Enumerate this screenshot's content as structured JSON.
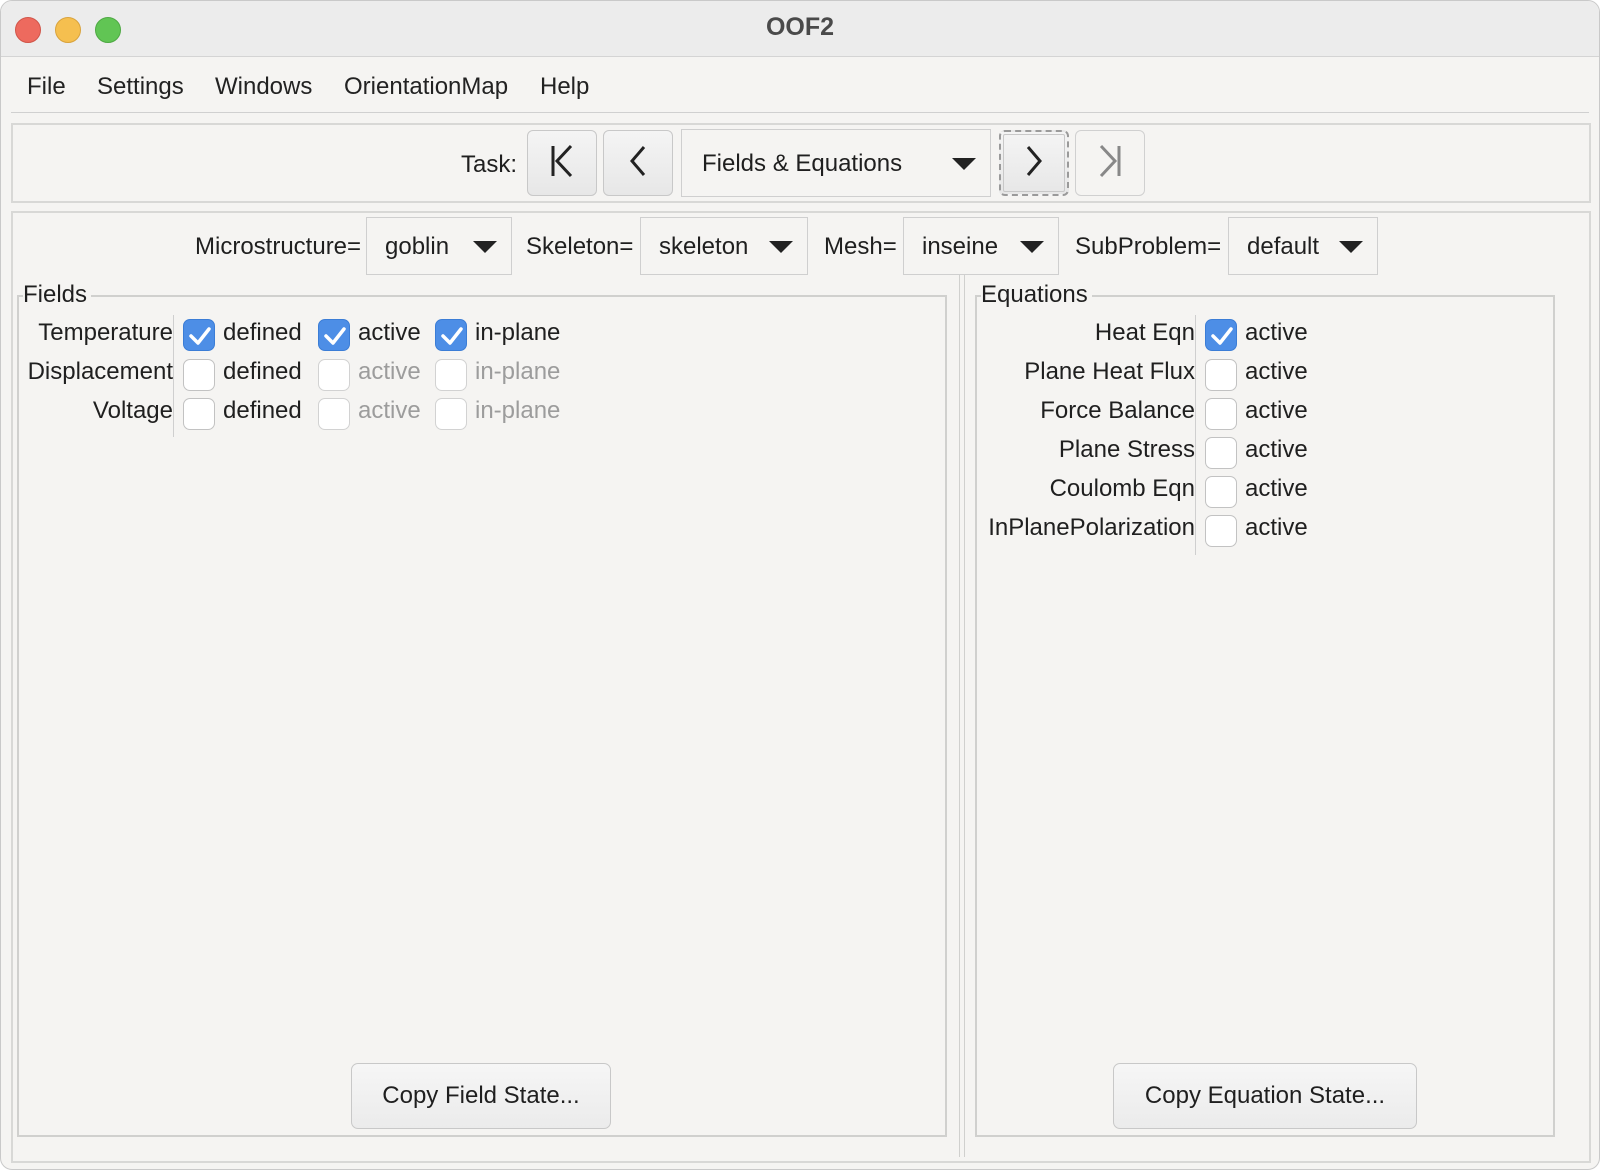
{
  "window": {
    "title": "OOF2"
  },
  "menu": [
    "File",
    "Settings",
    "Windows",
    "OrientationMap",
    "Help"
  ],
  "task": {
    "label": "Task:",
    "selected": "Fields & Equations"
  },
  "choosers": {
    "microstructure": {
      "label": "Microstructure=",
      "value": "goblin"
    },
    "skeleton": {
      "label": "Skeleton=",
      "value": "skeleton"
    },
    "mesh": {
      "label": "Mesh=",
      "value": "inseine"
    },
    "subproblem": {
      "label": "SubProblem=",
      "value": "default"
    }
  },
  "fields": {
    "title": "Fields",
    "rows": [
      {
        "name": "Temperature",
        "defined_label": "defined",
        "defined": true,
        "active_label": "active",
        "active": true,
        "inplane_label": "in-plane",
        "inplane": true
      },
      {
        "name": "Displacement",
        "defined_label": "defined",
        "defined": false,
        "active_label": "active",
        "active": false,
        "inplane_label": "in-plane",
        "inplane": false
      },
      {
        "name": "Voltage",
        "defined_label": "defined",
        "defined": false,
        "active_label": "active",
        "active": false,
        "inplane_label": "in-plane",
        "inplane": false
      }
    ],
    "copy_button": "Copy Field State..."
  },
  "equations": {
    "title": "Equations",
    "rows": [
      {
        "name": "Heat Eqn",
        "active_label": "active",
        "active": true
      },
      {
        "name": "Plane Heat Flux",
        "active_label": "active",
        "active": false
      },
      {
        "name": "Force Balance",
        "active_label": "active",
        "active": false
      },
      {
        "name": "Plane Stress",
        "active_label": "active",
        "active": false
      },
      {
        "name": "Coulomb Eqn",
        "active_label": "active",
        "active": false
      },
      {
        "name": "InPlanePolarization",
        "active_label": "active",
        "active": false
      }
    ],
    "copy_button": "Copy Equation State..."
  },
  "icons": {
    "first": "skip-to-first-icon",
    "prev": "chevron-left-icon",
    "next": "chevron-right-icon",
    "last": "skip-to-last-icon",
    "check": "checkmark-icon"
  },
  "colors": {
    "accent": "#4d8ee6",
    "window_bg": "#f5f4f2",
    "disabled_text": "#9c9c9c"
  }
}
